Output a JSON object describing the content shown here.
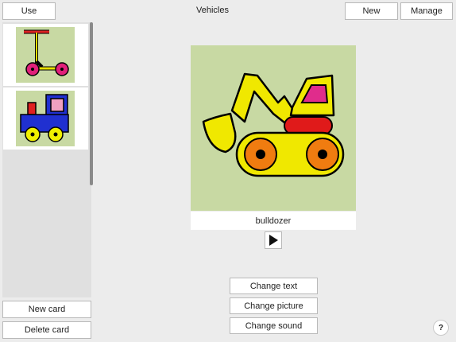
{
  "header": {
    "use_label": "Use",
    "title": "Vehicles",
    "new_label": "New",
    "manage_label": "Manage"
  },
  "sidebar": {
    "cards": [
      {
        "icon": "scooter-picture"
      },
      {
        "icon": "train-picture"
      }
    ],
    "new_card_label": "New card",
    "delete_card_label": "Delete card"
  },
  "card": {
    "icon": "bulldozer-picture",
    "caption": "bulldozer"
  },
  "actions": {
    "change_text": "Change text",
    "change_picture": "Change picture",
    "change_sound": "Change sound"
  },
  "help_label": "?",
  "colors": {
    "picture_background": "#c8d9a3",
    "panel_background": "#ececec"
  }
}
